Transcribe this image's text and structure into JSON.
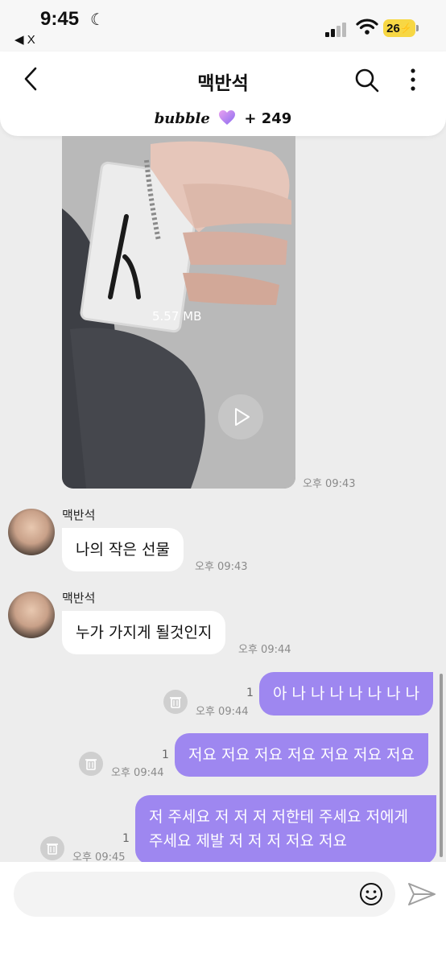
{
  "status_bar": {
    "time": "9:45",
    "back_label": "◀ X",
    "battery": "26"
  },
  "header": {
    "title": "맥반석",
    "bubble_brand": "bubble",
    "bubble_count": "+ 249"
  },
  "messages": {
    "video": {
      "size": "5.57 MB",
      "time": "오후 09:43"
    },
    "incoming": [
      {
        "sender": "맥반석",
        "text": "나의 작은 선물",
        "time": "오후 09:43"
      },
      {
        "sender": "맥반석",
        "text": "누가 가지게 될것인지",
        "time": "오후 09:44"
      }
    ],
    "outgoing": [
      {
        "text": "아 나 나 나 나 나 나 나",
        "time": "오후 09:44",
        "unread": "1"
      },
      {
        "text": "저요 저요 저요 저요 저요 저요 저요",
        "time": "오후 09:44",
        "unread": "1"
      },
      {
        "line1": "저 주세요 저 저 저 저한테 주세요 저에게",
        "line2": "주세요 제발 저 저 저 저요 저요",
        "time": "오후 09:45",
        "unread": "1"
      }
    ]
  },
  "composer": {
    "placeholder": ""
  },
  "colors": {
    "accent": "#9e87f0",
    "background": "#ededed",
    "battery": "#f7d744"
  },
  "icons": [
    "moon-icon",
    "signal-icon",
    "wifi-icon",
    "back-arrow-icon",
    "search-icon",
    "more-icon",
    "heart-icon",
    "play-icon",
    "trash-icon",
    "emoji-icon",
    "send-icon"
  ]
}
